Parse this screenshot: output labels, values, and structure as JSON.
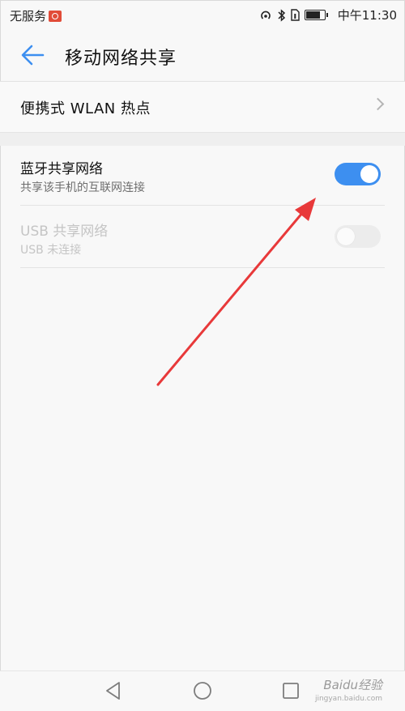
{
  "status_bar": {
    "carrier": "无服务",
    "carrier_icon": "carrier-badge-icon",
    "time": "中午11:30",
    "icons": [
      "hotspot-icon",
      "bluetooth-icon",
      "sim-icon",
      "battery-icon"
    ]
  },
  "app_bar": {
    "back_icon": "back-arrow-icon",
    "title": "移动网络共享"
  },
  "menu": {
    "wlan_hotspot_label": "便携式 WLAN 热点"
  },
  "settings": {
    "bluetooth": {
      "title": "蓝牙共享网络",
      "subtitle": "共享该手机的互联网连接",
      "enabled": true
    },
    "usb": {
      "title": "USB 共享网络",
      "subtitle": "USB 未连接",
      "enabled": false,
      "disabled": true
    }
  },
  "nav_bar": {
    "buttons": [
      "back-triangle-icon",
      "home-circle-icon",
      "recents-square-icon"
    ]
  },
  "watermark": {
    "text": "Baidu经验",
    "sub": "jingyan.baidu.com"
  },
  "colors": {
    "accent": "#3d8ff0",
    "annotation_arrow": "#e8393a"
  }
}
